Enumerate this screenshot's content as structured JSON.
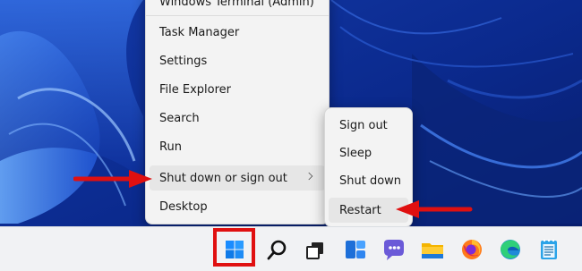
{
  "context_menu": {
    "items": [
      {
        "label": "Windows Terminal (Admin)"
      },
      {
        "label": "Task Manager"
      },
      {
        "label": "Settings"
      },
      {
        "label": "File Explorer"
      },
      {
        "label": "Search"
      },
      {
        "label": "Run"
      },
      {
        "label": "Shut down or sign out",
        "highlighted": true,
        "has_submenu": true
      },
      {
        "label": "Desktop"
      }
    ]
  },
  "submenu": {
    "items": [
      {
        "label": "Sign out"
      },
      {
        "label": "Sleep"
      },
      {
        "label": "Shut down"
      },
      {
        "label": "Restart",
        "highlighted": true
      }
    ]
  },
  "taskbar": {
    "icons": [
      "start-icon",
      "search-icon",
      "task-view-icon",
      "widgets-icon",
      "teams-chat-icon",
      "file-explorer-icon",
      "firefox-icon",
      "edge-icon",
      "notepad-icon"
    ],
    "highlighted_icon": "start-icon"
  },
  "annotations": {
    "color": "#e01010",
    "arrow_targets": [
      "Shut down or sign out",
      "Restart"
    ]
  },
  "colors": {
    "wallpaper_dark": "#0a2a8a",
    "wallpaper_light": "#4a8ff0",
    "menu_bg": "#f3f3f3",
    "hover_bg": "#e6e6e6",
    "taskbar_bg": "#f1f2f4"
  }
}
